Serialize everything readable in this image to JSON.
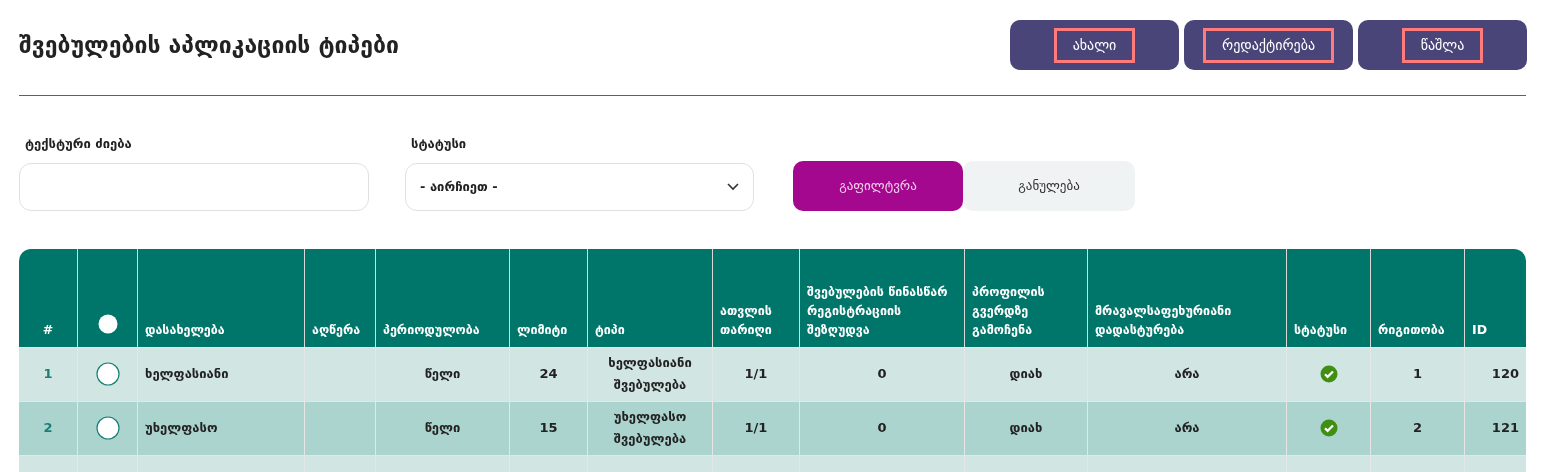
{
  "title": "შვებულების აპლიკაციის ტიპები",
  "actions": [
    {
      "label": "ახალი",
      "highlighted": true
    },
    {
      "label": "რედაქტირება",
      "highlighted": true
    },
    {
      "label": "წაშლა",
      "highlighted": true
    }
  ],
  "filters": {
    "text_search": {
      "label": "ტექსტური ძიება"
    },
    "status": {
      "label": "სტატუსი",
      "value": "- აირჩიეთ -"
    },
    "apply": "გაფილტვრა",
    "reset": "განულება"
  },
  "table": {
    "select_all": false,
    "columns": [
      "#",
      "",
      "დასახელება",
      "აღწერა",
      "პერიოდულობა",
      "ლიმიტი",
      "ტიპი",
      "ათვლის თარიღი",
      "შვებულების წინასწარ რეგისტრაციის შეზღუდვა",
      "პროფილის გვერდზე გამოჩენა",
      "მრავალსაფეხურიანი დადასტურება",
      "სტატუსი",
      "რიგითობა",
      "ID"
    ],
    "rows": [
      {
        "number": "1",
        "selected": false,
        "name": "ხელფასიანი",
        "description": "",
        "period": "წელი",
        "limit": "24",
        "type": "ხელფასიანი შვებულება",
        "start_date": "1/1",
        "restriction": "0",
        "profile": "დიახ",
        "multi_step": "არა",
        "active": true,
        "order": "1",
        "id": "120"
      },
      {
        "number": "2",
        "selected": false,
        "name": "უხელფასო",
        "description": "",
        "period": "წელი",
        "limit": "15",
        "type": "უხელფასო შვებულება",
        "start_date": "1/1",
        "restriction": "0",
        "profile": "დიახ",
        "multi_step": "არა",
        "active": true,
        "order": "2",
        "id": "121"
      }
    ]
  }
}
